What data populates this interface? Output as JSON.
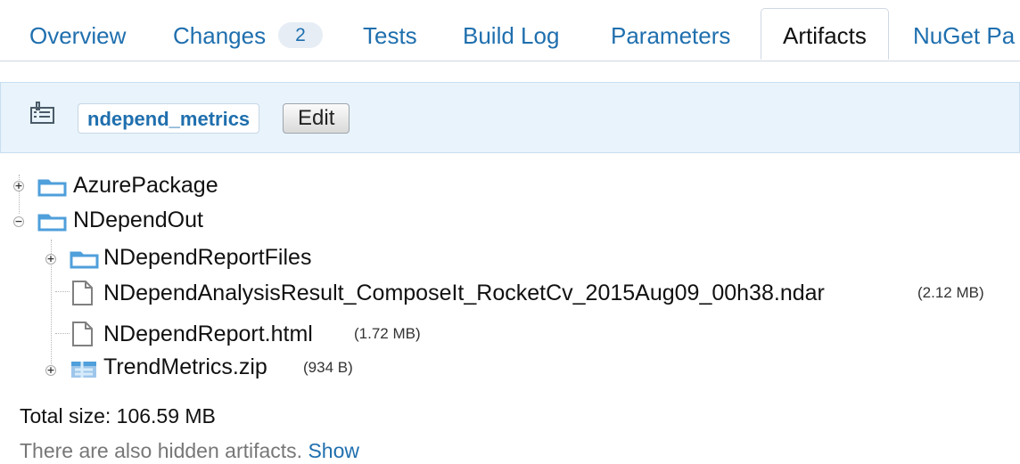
{
  "tabs": [
    {
      "label": "Overview",
      "active": false
    },
    {
      "label": "Changes",
      "badge": "2",
      "active": false
    },
    {
      "label": "Tests",
      "active": false
    },
    {
      "label": "Build Log",
      "active": false
    },
    {
      "label": "Parameters",
      "active": false
    },
    {
      "label": "Artifacts",
      "active": true
    },
    {
      "label": "NuGet Pa",
      "active": false
    }
  ],
  "toolbar": {
    "config_name": "ndepend_metrics",
    "edit_label": "Edit",
    "config_icon": "build-configuration-icon"
  },
  "tree": {
    "items": [
      {
        "name": "AzurePackage",
        "kind": "folder",
        "toggle": "+",
        "icon": "folder-icon"
      },
      {
        "name": "NDependOut",
        "kind": "folder",
        "toggle": "−",
        "icon": "folder-icon"
      },
      {
        "name": "NDependReportFiles",
        "kind": "folder",
        "toggle": "+",
        "icon": "folder-icon"
      },
      {
        "name": "NDependAnalysisResult_ComposeIt_RocketCv_2015Aug09_00h38.ndar",
        "kind": "file",
        "size": "(2.12 MB)",
        "icon": "document-icon"
      },
      {
        "name": "NDependReport.html",
        "kind": "file",
        "size": "(1.72 MB)",
        "icon": "document-icon"
      },
      {
        "name": "TrendMetrics.zip",
        "kind": "archive",
        "toggle": "+",
        "size": "(934 B)",
        "icon": "zip-archive-icon"
      }
    ]
  },
  "footer": {
    "total_size": "Total size: 106.59 MB",
    "hidden_text": "There are also hidden artifacts.",
    "show_label": "Show"
  },
  "colors": {
    "link": "#1f6fae",
    "toolbar_background": "#e8f3fb",
    "folder": "#4f9fdb",
    "badge_background": "#e6edf5"
  }
}
